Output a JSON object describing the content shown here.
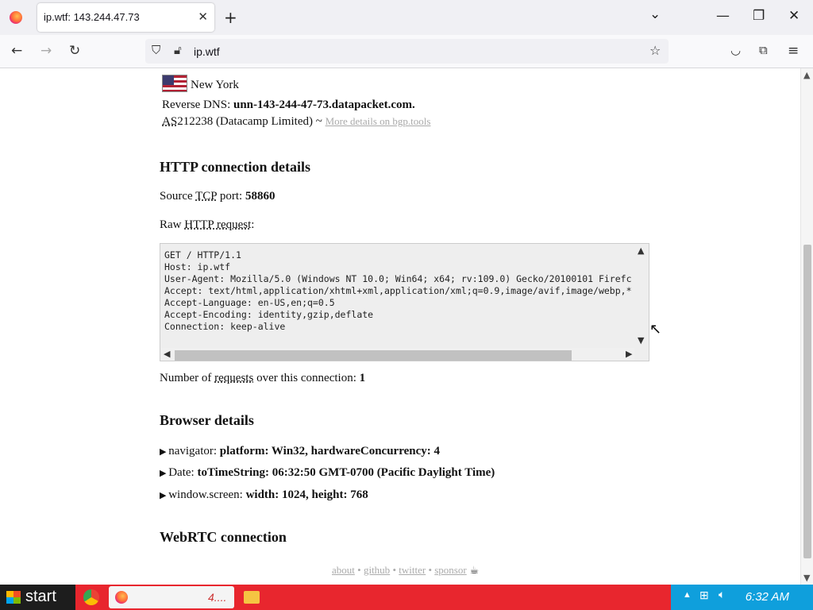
{
  "browser": {
    "tab_title": "ip.wtf: 143.244.47.73",
    "url": "ip.wtf",
    "new_tab": "+",
    "tab_close": "✕",
    "tabs_menu": "⌄"
  },
  "location": {
    "city": "New York",
    "reverse_dns_label": "Reverse DNS: ",
    "reverse_dns_value": "unn-143-244-47-73.datapacket.com.",
    "as_prefix": "AS",
    "as_number": "212238 (Datacamp Limited) ~ ",
    "bgp_link": "More details on bgp.tools"
  },
  "http": {
    "heading": "HTTP connection details",
    "source_label_pre": "Source ",
    "source_tcp": "TCP",
    "source_label_post": " port: ",
    "source_port": "58860",
    "raw_label_pre": "Raw ",
    "raw_label_abbr": "HTTP request",
    "raw_label_post": ":",
    "raw_request": "GET / HTTP/1.1\nHost: ip.wtf\nUser-Agent: Mozilla/5.0 (Windows NT 10.0; Win64; x64; rv:109.0) Gecko/20100101 Firefc\nAccept: text/html,application/xhtml+xml,application/xml;q=0.9,image/avif,image/webp,*\nAccept-Language: en-US,en;q=0.5\nAccept-Encoding: identity,gzip,deflate\nConnection: keep-alive",
    "requests_pre": "Number of ",
    "requests_abbr": "requests",
    "requests_post": " over this connection: ",
    "requests_count": "1"
  },
  "browser_details": {
    "heading": "Browser details",
    "items": [
      {
        "label": "navigator: ",
        "value": "platform: Win32, hardwareConcurrency: 4"
      },
      {
        "label": "Date: ",
        "value": "toTimeString: 06:32:50 GMT-0700 (Pacific Daylight Time)"
      },
      {
        "label": "window.screen: ",
        "value": "width: 1024, height: 768"
      }
    ]
  },
  "webrtc": {
    "heading": "WebRTC connection"
  },
  "footer": {
    "about": "about",
    "github": "github",
    "twitter": "twitter",
    "sponsor": "sponsor",
    "sep": " • "
  },
  "taskbar": {
    "start": "start",
    "clock": "6:32 AM",
    "task_label": "4...."
  }
}
